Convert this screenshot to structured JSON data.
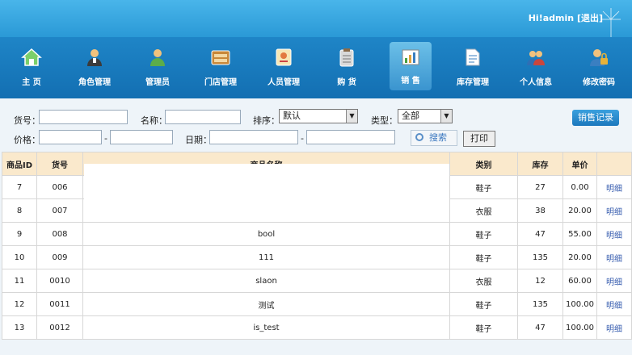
{
  "header": {
    "greeting_prefix": "Hi!",
    "username": "admin",
    "logout": "[退出]"
  },
  "nav": [
    {
      "label": "主 页",
      "icon": "home-icon"
    },
    {
      "label": "角色管理",
      "icon": "role-person-icon"
    },
    {
      "label": "管理员",
      "icon": "admin-person-icon"
    },
    {
      "label": "门店管理",
      "icon": "store-icon"
    },
    {
      "label": "人员管理",
      "icon": "staff-card-icon"
    },
    {
      "label": "购 货",
      "icon": "purchase-clipboard-icon"
    },
    {
      "label": "销 售",
      "icon": "sales-chart-icon",
      "active": true
    },
    {
      "label": "库存管理",
      "icon": "inventory-document-icon"
    },
    {
      "label": "个人信息",
      "icon": "user-group-icon"
    },
    {
      "label": "修改密码",
      "icon": "lock-user-icon"
    }
  ],
  "filter": {
    "sku_label": "货号：",
    "name_label": "名称：",
    "sort_label": "排序：",
    "sort_value": "默认",
    "type_label": "类型：",
    "type_value": "全部",
    "price_label": "价格：",
    "price_sep": "-",
    "date_label": "日期：",
    "date_sep": "-",
    "search_button": "搜索",
    "print_button": "打印",
    "records_button": "销售记录"
  },
  "table": {
    "columns": [
      "商品ID",
      "货号",
      "商品名称",
      "类别",
      "库存",
      "单价",
      ""
    ],
    "rows": [
      {
        "id": "7",
        "sku": "006",
        "name": "",
        "category": "鞋子",
        "stock": "27",
        "price": "0.00",
        "action": "明细"
      },
      {
        "id": "8",
        "sku": "007",
        "name": "",
        "category": "衣服",
        "stock": "38",
        "price": "20.00",
        "action": "明细"
      },
      {
        "id": "9",
        "sku": "008",
        "name": "bool",
        "category": "鞋子",
        "stock": "47",
        "price": "55.00",
        "action": "明细"
      },
      {
        "id": "10",
        "sku": "009",
        "name": "111",
        "category": "鞋子",
        "stock": "135",
        "price": "20.00",
        "action": "明细"
      },
      {
        "id": "11",
        "sku": "0010",
        "name": "slaon",
        "category": "衣服",
        "stock": "12",
        "price": "60.00",
        "action": "明细"
      },
      {
        "id": "12",
        "sku": "0011",
        "name": "测试",
        "category": "鞋子",
        "stock": "135",
        "price": "100.00",
        "action": "明细"
      },
      {
        "id": "13",
        "sku": "0012",
        "name": "is_test",
        "category": "鞋子",
        "stock": "47",
        "price": "100.00",
        "action": "明细"
      }
    ]
  }
}
